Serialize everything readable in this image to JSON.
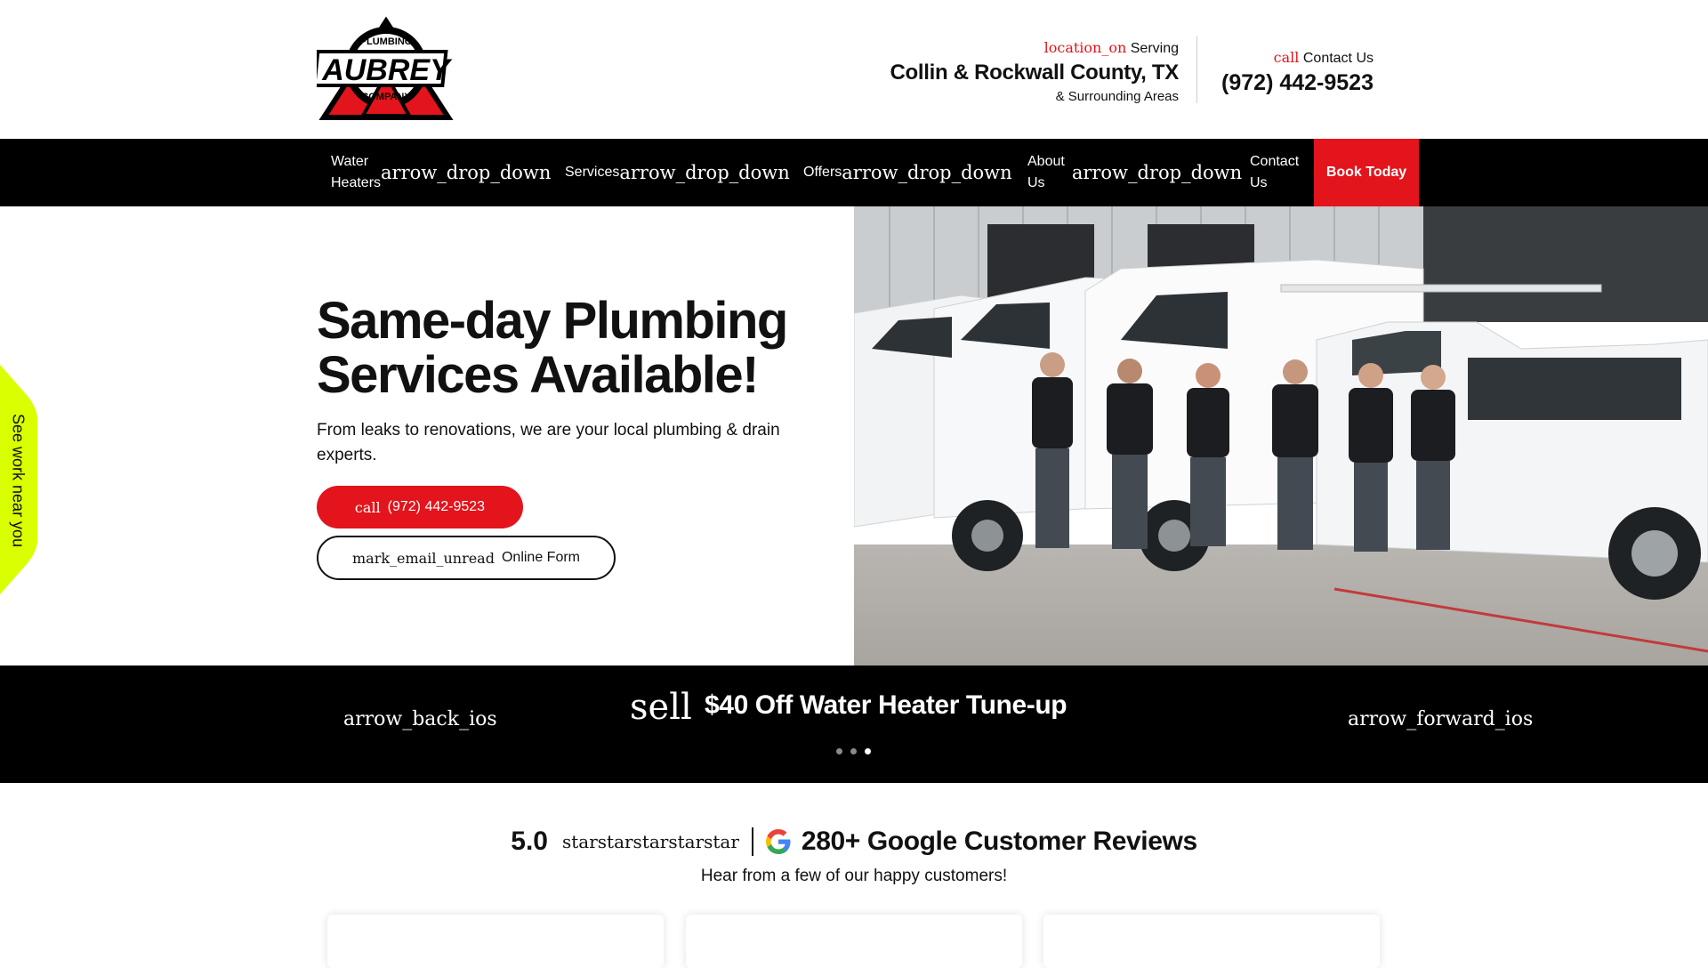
{
  "header": {
    "logo": {
      "top_text": "PLUMBING",
      "main_text": "AUBREY",
      "bottom_text": "COMPANY"
    },
    "serving": {
      "icon": "location_on",
      "label": "Serving",
      "area": "Collin & Rockwall County, TX",
      "subtext": "& Surrounding Areas"
    },
    "contact": {
      "icon": "call",
      "label": "Contact Us",
      "phone": "(972) 442-9523"
    }
  },
  "nav": {
    "items": [
      {
        "label_line1": "Water",
        "label_line2": "Heaters",
        "icon": "arrow_drop_down"
      },
      {
        "label_line1": "Services",
        "label_line2": "",
        "icon": "arrow_drop_down"
      },
      {
        "label_line1": "Offers",
        "label_line2": "",
        "icon": "arrow_drop_down"
      },
      {
        "label_line1": "About",
        "label_line2": "Us",
        "icon": "arrow_drop_down"
      },
      {
        "label_line1": "Contact",
        "label_line2": "Us",
        "icon": ""
      }
    ],
    "book_label": "Book Today"
  },
  "hero": {
    "title": "Same-day Plumbing Services Available!",
    "subtitle": "From leaks to renovations, we are your local plumbing & drain experts.",
    "call_button": {
      "icon": "call",
      "label": "(972) 442-9523"
    },
    "form_button": {
      "icon": "mark_email_unread",
      "label": "Online Form"
    },
    "side_tab": "See work near you"
  },
  "promo": {
    "prev_icon": "arrow_back_ios",
    "next_icon": "arrow_forward_ios",
    "offer_icon": "sell",
    "offer_text": "$40 Off Water Heater Tune-up",
    "slides_count": 3,
    "active_slide": 3
  },
  "reviews": {
    "rating": "5.0",
    "stars": "starstarstarstarstar",
    "title": "280+ Google Customer Reviews",
    "subtitle": "Hear from a few of our happy customers!"
  },
  "colors": {
    "brand_red": "#e3141b",
    "black": "#000000",
    "accent_lime": "#d9ff00"
  }
}
